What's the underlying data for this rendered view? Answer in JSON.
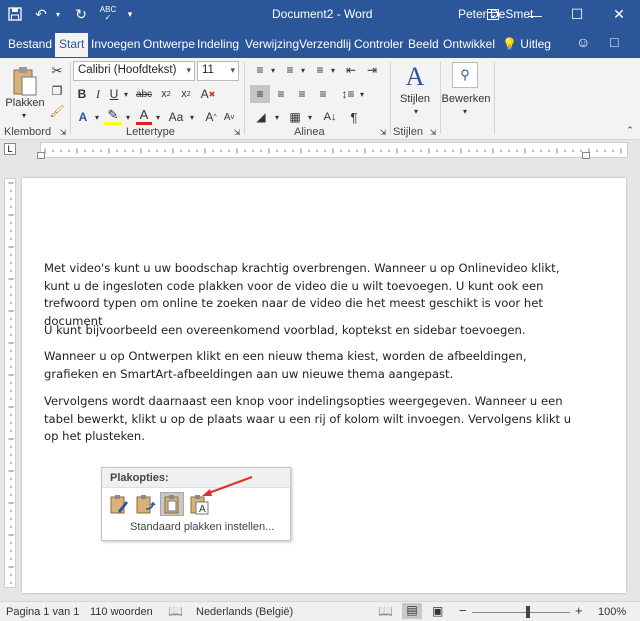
{
  "titlebar": {
    "document_title": "Document2 - Word",
    "user_name": "Peter DeSmet"
  },
  "tabs": [
    {
      "label": "Bestand"
    },
    {
      "label": "Start"
    },
    {
      "label": "Invoegen"
    },
    {
      "label": "Ontwerpe"
    },
    {
      "label": "Indeling"
    },
    {
      "label": "Verwijzing"
    },
    {
      "label": "Verzendlij"
    },
    {
      "label": "Controler"
    },
    {
      "label": "Beeld"
    },
    {
      "label": "Ontwikkel"
    },
    {
      "label": "Uitleg"
    }
  ],
  "ribbon": {
    "paste_label": "Plakken",
    "font_name": "Calibri (Hoofdtekst)",
    "font_size": "11",
    "styles_label": "Stijlen",
    "edit_label": "Bewerken",
    "groups": {
      "clipboard": "Klembord",
      "font": "Lettertype",
      "paragraph": "Alinea",
      "styles": "Stijlen"
    },
    "accent_color": "#2b579a"
  },
  "document": {
    "paragraphs": [
      "Met video's kunt u uw boodschap krachtig overbrengen. Wanneer u op Onlinevideo klikt, kunt u de ingesloten code plakken voor de video die u wilt toevoegen. U kunt ook een trefwoord typen om online te zoeken naar de video die het meest geschikt is voor het document",
      "U kunt bijvoorbeeld een overeenkomend voorblad, koptekst en sidebar toevoegen.",
      "Wanneer u op Ontwerpen klikt en een nieuw thema kiest, worden de afbeeldingen, grafieken en SmartArt-afbeeldingen aan uw nieuwe thema aangepast.",
      "Vervolgens wordt daarnaast een knop voor indelingsopties weergegeven. Wanneer u een tabel bewerkt, klikt u op de plaats waar u een rij of kolom wilt invoegen. Vervolgens klikt u op het plusteken."
    ]
  },
  "paste_popup": {
    "title": "Plakopties:",
    "set_default": "Standaard plakken instellen..."
  },
  "statusbar": {
    "page": "Pagina 1 van 1",
    "words": "110 woorden",
    "language": "Nederlands (België)",
    "zoom": "100%"
  }
}
